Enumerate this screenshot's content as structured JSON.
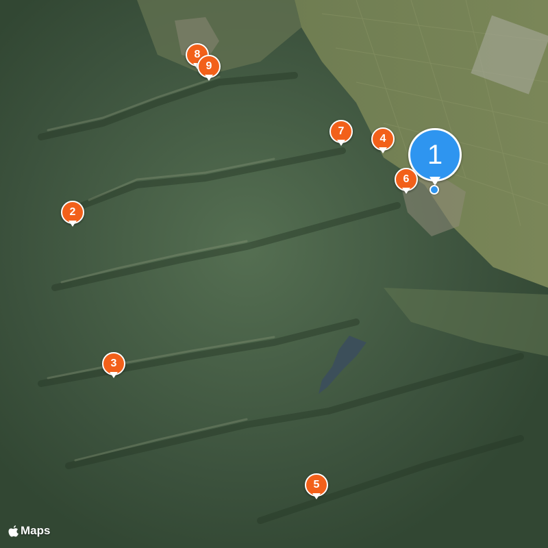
{
  "map": {
    "attribution": "Maps",
    "brand_icon": "apple-logo-icon",
    "colors": {
      "pin_orange": "#f2601a",
      "pin_blue": "#2e95f0",
      "terrain_dark": "#2f4431",
      "terrain_mid": "#4f6a4e",
      "plain": "#6b7c4f"
    }
  },
  "pins": [
    {
      "label": "1",
      "type": "primary"
    },
    {
      "label": "2",
      "type": "secondary"
    },
    {
      "label": "3",
      "type": "secondary"
    },
    {
      "label": "4",
      "type": "secondary"
    },
    {
      "label": "5",
      "type": "secondary"
    },
    {
      "label": "6",
      "type": "secondary"
    },
    {
      "label": "7",
      "type": "secondary"
    },
    {
      "label": "8",
      "type": "secondary"
    },
    {
      "label": "9",
      "type": "secondary"
    }
  ]
}
